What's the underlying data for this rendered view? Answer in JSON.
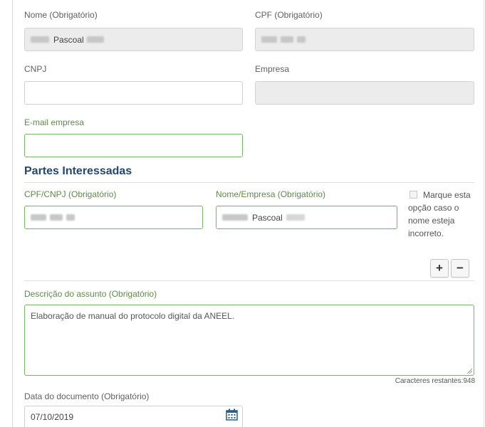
{
  "form": {
    "nome_label": "Nome (Obrigatório)",
    "nome_value_visible": "Pascoal",
    "cpf_label": "CPF (Obrigatório)",
    "cnpj_label": "CNPJ",
    "empresa_label": "Empresa",
    "email_label": "E-mail empresa"
  },
  "partes": {
    "title": "Partes Interessadas",
    "cpf_cnpj_label": "CPF/CNPJ (Obrigatório)",
    "nome_empresa_label": "Nome/Empresa (Obrigatório)",
    "nome_empresa_value_visible": "Pascoal",
    "checkbox_line1": "Marque esta",
    "checkbox_line2": "opção caso o",
    "checkbox_line3": "nome esteja",
    "checkbox_line4": "incorreto.",
    "add_label": "+",
    "remove_label": "−"
  },
  "descricao": {
    "label": "Descrição do assunto (Obrigatório)",
    "value": "Elaboração de manual do protocolo digital da ANEEL.",
    "counter": "Caracteres restantes:948"
  },
  "data_doc": {
    "label": "Data do documento (Obrigatório)",
    "value": "07/10/2019",
    "icon": "calendar-icon"
  },
  "colors": {
    "valid_border": "#7fb06a",
    "section_title": "#26476b",
    "readonly_bg": "#ececec"
  }
}
